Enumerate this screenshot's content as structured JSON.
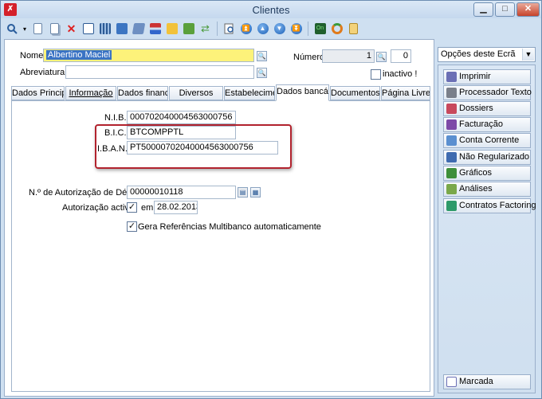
{
  "window": {
    "title": "Clientes"
  },
  "colors": {
    "highlight_box": "#b2232e",
    "name_field": "#fdf27a"
  },
  "toolbar": {
    "icons": [
      "search-icon",
      "dropdown-arrow-icon",
      "new-document-icon",
      "copy-document-icon",
      "delete-icon",
      "edit-icon",
      "grid-icon",
      "folder-icon",
      "box-icon",
      "hierarchy-icon",
      "mail-icon",
      "folder-open-icon",
      "refresh-icon",
      "print-preview-icon",
      "first-record-icon",
      "previous-record-icon",
      "next-record-icon",
      "last-record-icon",
      "online-icon",
      "sync-icon",
      "document-copy-icon"
    ]
  },
  "form": {
    "nome_label": "Nome",
    "nome_value": "Albertino Maciel",
    "abreviatura_label": "Abreviatura",
    "abreviatura_value": "",
    "numero_label": "Número",
    "numero_value": "1",
    "numero_aux": "0",
    "inactivo_label": "inactivo !"
  },
  "tabs": [
    {
      "label": "Dados Principai"
    },
    {
      "label": "Informação"
    },
    {
      "label": "Dados financeir"
    },
    {
      "label": "Diversos"
    },
    {
      "label": "Estabeleciment"
    },
    {
      "label": "Dados bancário"
    },
    {
      "label": "Documentos de"
    },
    {
      "label": "Página Livre"
    }
  ],
  "bank": {
    "nib_label": "N.I.B.",
    "nib_value": "000702040004563000756",
    "bic_label": "B.I.C.",
    "bic_value": "BTCOMPPTL",
    "iban_label": "I.B.A.N.",
    "iban_value": "PT50000702040004563000756",
    "debito_label": "N.º de Autorização de Débito",
    "debito_value": "00000010118",
    "autorizacao_label": "Autorização activa",
    "autorizacao_checked": true,
    "em_label": "em",
    "em_value": "28.02.2013",
    "gera_label": "Gera Referências Multibanco automaticamente",
    "gera_checked": true
  },
  "side": {
    "combo_label": "Opções deste Ecrã",
    "buttons": [
      {
        "label": "Imprimir",
        "color": "#6b6fb5"
      },
      {
        "label": "Processador Texto",
        "color": "#7a7f8a"
      },
      {
        "label": "Dossiers",
        "color": "#c8485c"
      },
      {
        "label": "Facturação",
        "color": "#7d4aa8"
      },
      {
        "label": "Conta Corrente",
        "color": "#5a8fd0"
      },
      {
        "label": "Não Regularizado",
        "color": "#3f6bb0"
      },
      {
        "label": "Gráficos",
        "color": "#3e8f3a"
      },
      {
        "label": "Análises",
        "color": "#7aa84a"
      },
      {
        "label": "Contratos Factoring",
        "color": "#2e9a6a"
      }
    ],
    "marcada_label": "Marcada"
  }
}
